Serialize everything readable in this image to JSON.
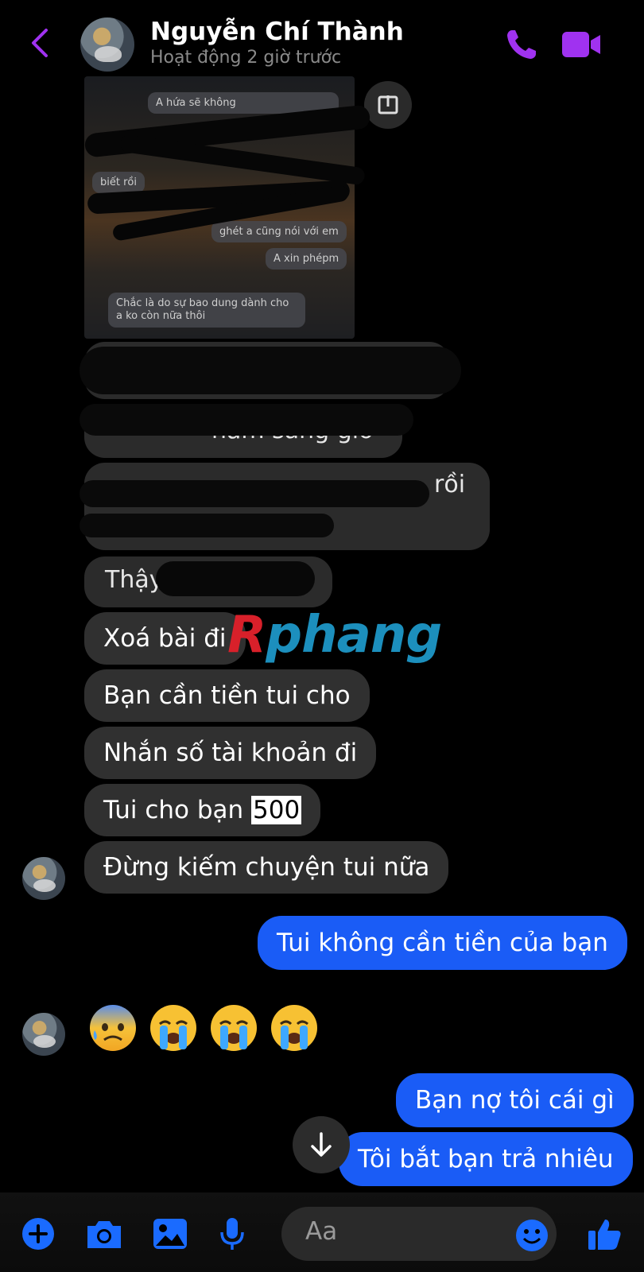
{
  "header": {
    "contact_name": "Nguyễn Chí Thành",
    "status": "Hoạt động 2 giờ trước"
  },
  "shared_image": {
    "snippets": [
      "A hứa sẽ không",
      "biết rồi",
      "ghét a cũng nói với em",
      "A xin phépm",
      "Chắc là do sự bao dung dành cho a ko còn nữa thôi"
    ]
  },
  "obscured_bubbles": {
    "b1": "năm sáng giờ",
    "b2": "rồi",
    "b3": "Thậy"
  },
  "incoming": {
    "m1": "Xoá bài đi",
    "m2": "Bạn cần tiền tui cho",
    "m3": "Nhắn số tài khoản đi",
    "m4_prefix": "Tui cho bạn ",
    "m4_amount": "500",
    "m5": "Đừng kiếm chuyện tui nữa"
  },
  "outgoing": {
    "o1": "Tui không cần tiền của bạn",
    "o2": "Bạn nợ tôi cái gì",
    "o3": "Tôi bắt bạn trả nhiêu"
  },
  "emoji_reaction": [
    "anxious-face-with-sweat",
    "loudly-crying-face",
    "loudly-crying-face",
    "loudly-crying-face"
  ],
  "watermark": {
    "first": "R",
    "rest": "phang"
  },
  "composer": {
    "placeholder": "Aa"
  },
  "colors": {
    "accent": "#a032f0",
    "outgoing_bubble": "#1a5cf6",
    "incoming_bubble": "#303030",
    "composer_icons": "#1a6bff"
  }
}
